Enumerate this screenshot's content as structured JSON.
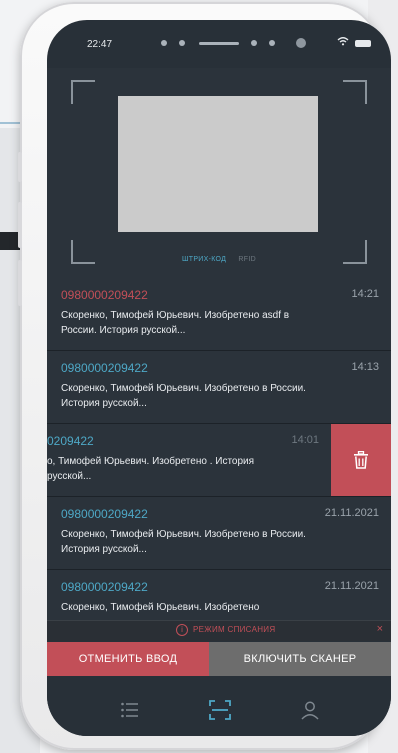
{
  "status_bar": {
    "time": "22:47"
  },
  "scanner": {
    "modes": [
      {
        "label": "ШТРИХ-КОД",
        "active": true
      },
      {
        "label": "RFID",
        "active": false
      }
    ]
  },
  "colors": {
    "accent": "#4ea8c6",
    "danger": "#c24f58",
    "background": "#283038",
    "card": "#2b333b",
    "disabled": "#6d6d6d"
  },
  "records": [
    {
      "code": "0980000209422",
      "time": "14:21",
      "desc": "Скоренко, Тимофей Юрьевич. Изобретено asdf в России. История русской...",
      "code_color": "#c24f58"
    },
    {
      "code": "0980000209422",
      "time": "14:13",
      "desc": "Скоренко, Тимофей Юрьевич. Изобретено в России. История русской...",
      "code_color": "#4ea8c6"
    },
    {
      "code": "0209422",
      "time": "14:01",
      "desc": "о, Тимофей Юрьевич. Изобретено . История русской...",
      "code_color": "#4ea8c6",
      "swiped": true
    },
    {
      "code": "0980000209422",
      "time": "21.11.2021",
      "desc": "Скоренко, Тимофей Юрьевич. Изобретено в России. История русской...",
      "code_color": "#4ea8c6"
    },
    {
      "code": "0980000209422",
      "time": "21.11.2021",
      "desc": "Скоренко, Тимофей Юрьевич. Изобретено",
      "code_color": "#4ea8c6"
    }
  ],
  "notice": {
    "label": "РЕЖИМ СПИСАНИЯ",
    "close_glyph": "×",
    "info_glyph": "i"
  },
  "actions": {
    "cancel_label": "ОТМЕНИТЬ ВВОД",
    "scan_label": "ВКЛЮЧИТЬ СКАНЕР"
  },
  "tabbar": [
    {
      "icon": "list-icon",
      "active": false
    },
    {
      "icon": "scan-icon",
      "active": true
    },
    {
      "icon": "profile-icon",
      "active": false
    }
  ]
}
